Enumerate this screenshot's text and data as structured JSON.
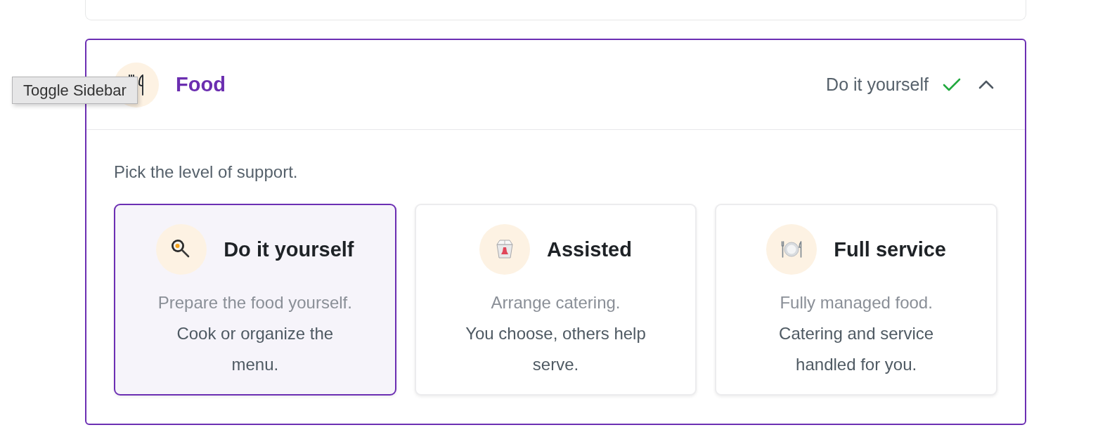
{
  "tooltip": {
    "text": "Toggle Sidebar"
  },
  "section": {
    "title": "Food",
    "summary": "Do it yourself",
    "complete": true,
    "expanded": true,
    "prompt": "Pick the level of support.",
    "options": [
      {
        "title": "Do it yourself",
        "subtitle": "Prepare the food yourself.",
        "description": "Cook or organize the menu.",
        "selected": true
      },
      {
        "title": "Assisted",
        "subtitle": "Arrange catering.",
        "description": "You choose, others help serve.",
        "selected": false
      },
      {
        "title": "Full service",
        "subtitle": "Fully managed food.",
        "description": "Catering and service handled for you.",
        "selected": false
      }
    ]
  }
}
